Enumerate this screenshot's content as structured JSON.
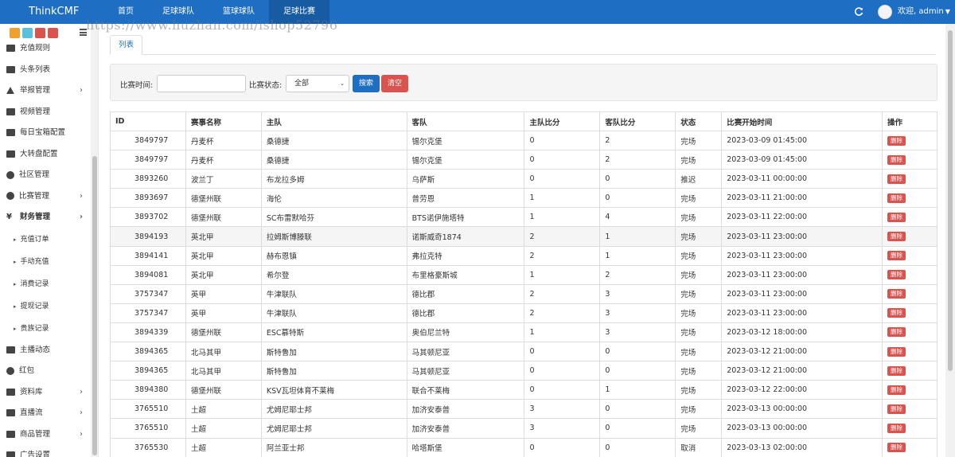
{
  "brand": "ThinkCMF",
  "topnav": [
    "首页",
    "足球球队",
    "篮球球队",
    "足球比赛"
  ],
  "user_greeting": "欢迎, admin",
  "watermark": "https://www.huzhan.com/ishop52796",
  "sidebar": {
    "items": [
      {
        "label": "充值规则",
        "icon": "gift-icon"
      },
      {
        "label": "头条列表",
        "icon": "desktop-icon"
      },
      {
        "label": "举报管理",
        "icon": "warning-icon",
        "chevron": true
      },
      {
        "label": "视频管理",
        "icon": "file-icon"
      },
      {
        "label": "每日宝箱配置",
        "icon": "desktop-icon"
      },
      {
        "label": "大转盘配置",
        "icon": "desktop-icon"
      },
      {
        "label": "社区管理",
        "icon": "comment-icon"
      },
      {
        "label": "比赛管理",
        "icon": "clock-icon",
        "chevron": true
      },
      {
        "label": "财务管理",
        "icon": "yen-icon",
        "chevron": true,
        "active": true
      }
    ],
    "subitems": [
      "充值订单",
      "手动充值",
      "消费记录",
      "提现记录",
      "贵族记录"
    ],
    "items_after": [
      {
        "label": "主播动态",
        "icon": "flag-icon"
      },
      {
        "label": "红包",
        "icon": "globe-icon"
      },
      {
        "label": "资料库",
        "icon": "desktop-icon",
        "chevron": true
      },
      {
        "label": "直播流",
        "icon": "tint-icon",
        "chevron": true
      },
      {
        "label": "商品管理",
        "icon": "desktop-icon",
        "chevron": true
      },
      {
        "label": "广告设置",
        "icon": "desktop-icon"
      }
    ]
  },
  "tab_label": "列表",
  "filter": {
    "time_label": "比赛时间:",
    "time_value": "",
    "status_label": "比赛状态:",
    "status_value": "全部",
    "search_label": "搜索",
    "clear_label": "清空"
  },
  "table": {
    "headers": [
      "ID",
      "赛事名称",
      "主队",
      "客队",
      "主队比分",
      "客队比分",
      "状态",
      "比赛开始时间",
      "操作"
    ],
    "delete_label": "删除",
    "rows": [
      [
        "3849797",
        "丹麦杯",
        "桑德捷",
        "锡尔克堡",
        "0",
        "2",
        "完场",
        "2023-03-09 01:45:00"
      ],
      [
        "3849797",
        "丹麦杯",
        "桑德捷",
        "锡尔克堡",
        "0",
        "2",
        "完场",
        "2023-03-09 01:45:00"
      ],
      [
        "3893260",
        "波兰丁",
        "布龙拉多姆",
        "乌萨斯",
        "0",
        "0",
        "推迟",
        "2023-03-11 00:00:00"
      ],
      [
        "3893697",
        "德堡州联",
        "海伦",
        "普劳恩",
        "1",
        "0",
        "完场",
        "2023-03-11 21:00:00"
      ],
      [
        "3893702",
        "德堡州联",
        "SC布雷默哈芬",
        "BTS诺伊施塔特",
        "1",
        "4",
        "完场",
        "2023-03-11 22:00:00"
      ],
      [
        "3894193",
        "英北甲",
        "拉姆斯博滕联",
        "诺斯威奇1874",
        "2",
        "1",
        "完场",
        "2023-03-11 23:00:00"
      ],
      [
        "3894141",
        "英北甲",
        "赫布恩镇",
        "弗拉克特",
        "2",
        "1",
        "完场",
        "2023-03-11 23:00:00"
      ],
      [
        "3894081",
        "英北甲",
        "希尔登",
        "布里格豪斯城",
        "1",
        "2",
        "完场",
        "2023-03-11 23:00:00"
      ],
      [
        "3757347",
        "英甲",
        "牛津联队",
        "德比郡",
        "2",
        "3",
        "完场",
        "2023-03-11 23:00:00"
      ],
      [
        "3757347",
        "英甲",
        "牛津联队",
        "德比郡",
        "2",
        "3",
        "完场",
        "2023-03-11 23:00:00"
      ],
      [
        "3894339",
        "德堡州联",
        "ESC慕特斯",
        "奥伯尼兰特",
        "1",
        "3",
        "完场",
        "2023-03-12 18:00:00"
      ],
      [
        "3894365",
        "北马其甲",
        "斯特鲁加",
        "马其顿尼亚",
        "0",
        "0",
        "完场",
        "2023-03-12 21:00:00"
      ],
      [
        "3894365",
        "北马其甲",
        "斯特鲁加",
        "马其顿尼亚",
        "0",
        "0",
        "完场",
        "2023-03-12 21:00:00"
      ],
      [
        "3894380",
        "德堡州联",
        "KSV瓦坦体育不莱梅",
        "联合不莱梅",
        "0",
        "1",
        "完场",
        "2023-03-12 22:00:00"
      ],
      [
        "3765510",
        "土超",
        "尤姆尼耶士邦",
        "加济安泰普",
        "3",
        "0",
        "完场",
        "2023-03-13 00:00:00"
      ],
      [
        "3765510",
        "土超",
        "尤姆尼耶士邦",
        "加济安泰普",
        "3",
        "0",
        "完场",
        "2023-03-13 00:00:00"
      ],
      [
        "3765530",
        "土超",
        "阿兰亚士邦",
        "哈塔斯堡",
        "0",
        "0",
        "取消",
        "2023-03-13 02:00:00"
      ]
    ],
    "highlight_row": 5
  }
}
